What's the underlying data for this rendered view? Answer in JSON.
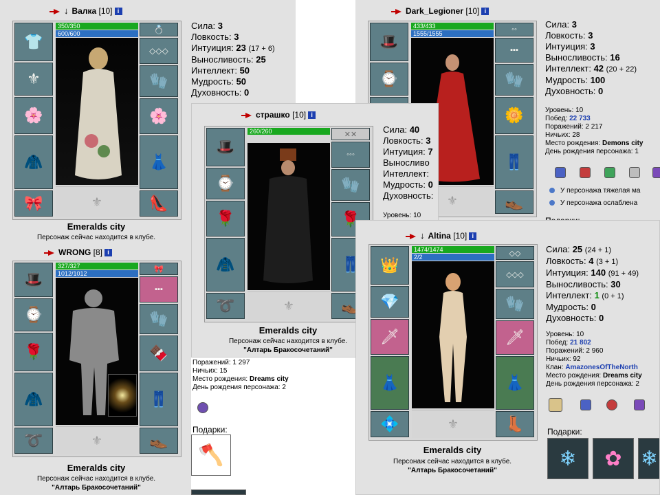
{
  "icons": {
    "info": "i",
    "arrow": "red-arrow-icon",
    "glyph": "♦"
  },
  "valka": {
    "name": "Валка",
    "level": "[10]",
    "hp": "350/350",
    "mp": "600/600",
    "stats": [
      {
        "label": "Сила:",
        "value": "3",
        "extra": ""
      },
      {
        "label": "Ловкость:",
        "value": "3",
        "extra": ""
      },
      {
        "label": "Интуиция:",
        "value": "23",
        "extra": "(17 + 6)"
      },
      {
        "label": "Выносливость:",
        "value": "25",
        "extra": ""
      },
      {
        "label": "Интеллект:",
        "value": "50",
        "extra": ""
      },
      {
        "label": "Мудрость:",
        "value": "50",
        "extra": ""
      },
      {
        "label": "Духовность:",
        "value": "0",
        "extra": ""
      }
    ],
    "city": "Emeralds city",
    "club": "Персонаж сейчас находится в клубе."
  },
  "dark": {
    "name": "Dark_Legioner",
    "level": "[10]",
    "hp": "433/433",
    "mp": "1555/1555",
    "stats": [
      {
        "label": "Сила:",
        "value": "3",
        "extra": ""
      },
      {
        "label": "Ловкость:",
        "value": "3",
        "extra": ""
      },
      {
        "label": "Интуиция:",
        "value": "3",
        "extra": ""
      },
      {
        "label": "Выносливость:",
        "value": "16",
        "extra": ""
      },
      {
        "label": "Интеллект:",
        "value": "42",
        "extra": "(20 + 22)"
      },
      {
        "label": "Мудрость:",
        "value": "100",
        "extra": ""
      },
      {
        "label": "Духовность:",
        "value": "0",
        "extra": ""
      }
    ],
    "info": {
      "level": "Уровень: 10",
      "wins_label": "Побед:",
      "wins": "22 733",
      "losses": "Поражений: 2 217",
      "draws": "Ничьих: 28",
      "birth_label": "Место рождения:",
      "birth": "Demons city",
      "bday": "День рождения персонажа: 1"
    },
    "effects": [
      "У персонажа тяжелая ма",
      "У персонажа ослаблена"
    ],
    "gifts": "Подарки:"
  },
  "strashko": {
    "name": "страшко",
    "level": "[10]",
    "hp": "260/260",
    "stats": [
      {
        "label": "Сила:",
        "value": "40",
        "extra": ""
      },
      {
        "label": "Ловкость:",
        "value": "3",
        "extra": ""
      },
      {
        "label": "Интуиция:",
        "value": "7",
        "extra": ""
      },
      {
        "label": "Выносливо",
        "value": "",
        "extra": ""
      },
      {
        "label": "Интеллект:",
        "value": "",
        "extra": ""
      },
      {
        "label": "Мудрость:",
        "value": "0",
        "extra": ""
      },
      {
        "label": "Духовность:",
        "value": "",
        "extra": ""
      }
    ],
    "level_line": "Уровень: 10",
    "city": "Emeralds city",
    "club": "Персонаж сейчас находится в клубе.",
    "location": "\"Алтарь Бракосочетаний\"",
    "losses": "Поражений: 1 297",
    "draws": "Ничьих: 15",
    "birth_label": "Место рождения:",
    "birth": "Dreams city",
    "bday": "День рождения персонажа: 2",
    "gifts": "Подарки:"
  },
  "wrong": {
    "name": "WRONG",
    "level": "[8]",
    "hp": "327/327",
    "mp": "1012/1012",
    "city": "Emeralds city",
    "club": "Персонаж сейчас находится в клубе.",
    "location": "\"Алтарь Бракосочетаний\""
  },
  "altina": {
    "name": "Altina",
    "level": "[10]",
    "hp": "1474/1474",
    "mp": "2/2",
    "stats": [
      {
        "label": "Сила:",
        "value": "25",
        "extra": "(24 + 1)"
      },
      {
        "label": "Ловкость:",
        "value": "4",
        "extra": "(3 + 1)"
      },
      {
        "label": "Интуиция:",
        "value": "140",
        "extra": "(91 + 49)"
      },
      {
        "label": "Выносливость:",
        "value": "30",
        "extra": ""
      },
      {
        "label": "Интеллект:",
        "value": "1",
        "extra": "(0 + 1)"
      },
      {
        "label": "Мудрость:",
        "value": "0",
        "extra": ""
      },
      {
        "label": "Духовность:",
        "value": "0",
        "extra": ""
      }
    ],
    "info": {
      "level": "Уровень: 10",
      "wins_label": "Побед:",
      "wins": "21 802",
      "losses": "Поражений: 2 960",
      "draws": "Ничьих: 92",
      "clan_label": "Клан:",
      "clan": "AmazonesOfTheNorth",
      "birth_label": "Место рождения:",
      "birth": "Dreams city",
      "bday": "День рождения персонажа: 2"
    },
    "city": "Emeralds city",
    "club": "Персонаж сейчас находится в клубе.",
    "location": "\"Алтарь Бракосочетаний\"",
    "gifts": "Подарки:"
  },
  "colors": {
    "hp": "#19a81f",
    "mp": "#2c6fc1",
    "slot": "#5e7f87",
    "panel": "#e2e2e2",
    "link": "#1c3fb0"
  }
}
